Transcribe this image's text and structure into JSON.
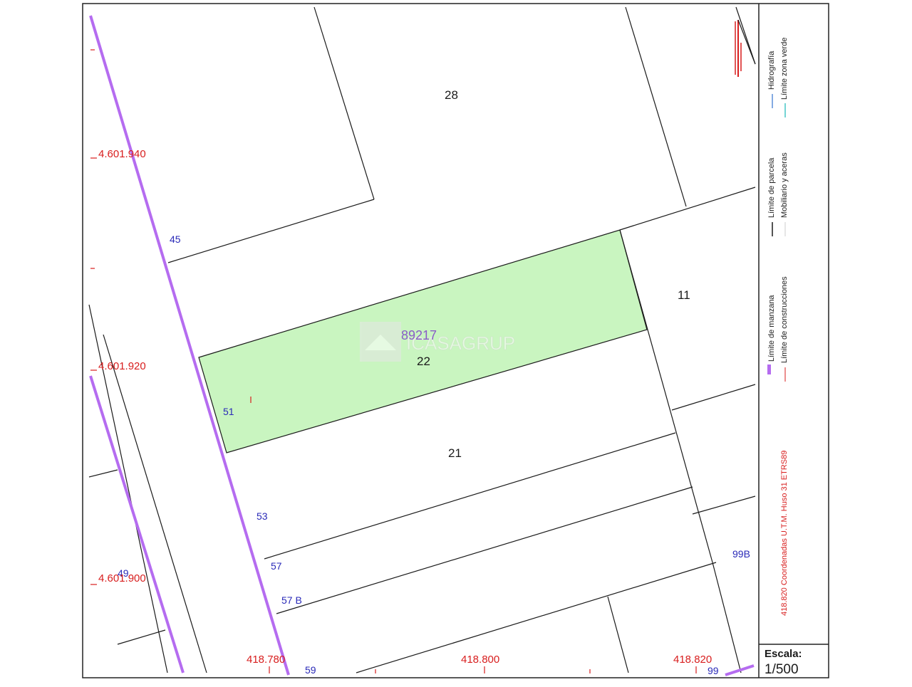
{
  "colors": {
    "block_boundary": "#b56cf0",
    "parcel_boundary": "#1a1a1a",
    "coordinates": "#d81e1e",
    "highlight_fill": "#c9f5c0",
    "house_numbers": "#2a2ab8",
    "hydrography": "#5a8fd8",
    "green_zone": "#46c6c6"
  },
  "map": {
    "parcel_labels": {
      "p28": "28",
      "p11": "11",
      "p22": "22",
      "p21": "21"
    },
    "highlight_parcel_ref": "89217",
    "watermark": "ICASAGRUP",
    "house_numbers": {
      "n45": "45",
      "n51": "51",
      "n53": "53",
      "n57": "57",
      "n57b": "57 B",
      "n59": "59",
      "n49": "49",
      "n99b": "99B",
      "n99": "99"
    },
    "coordinates_y": {
      "y940": "4.601.940",
      "y920": "4.601.920",
      "y900": "4.601.900"
    },
    "coordinates_x": {
      "x780": "418.780",
      "x800": "418.800",
      "x820": "418.820"
    }
  },
  "legend": {
    "block_limit": "Límite de manzana",
    "construction_limit": "Límite de construcciones",
    "parcel_limit": "Límite de parcela",
    "furniture_sidewalks": "Mobiliario y aceras",
    "hydrography": "Hidrografía",
    "green_zone_limit": "Límite zona verde",
    "coordinate_system": "418.820 Coordenadas U.T.M. Huso 31 ETRS89"
  },
  "scale": {
    "label": "Escala:",
    "value": "1/500"
  }
}
